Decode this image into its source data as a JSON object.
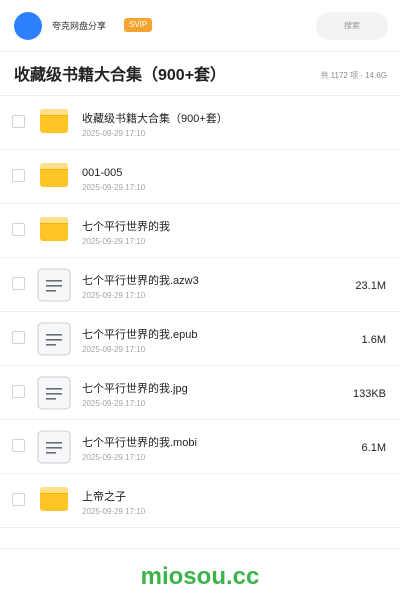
{
  "header": {
    "brand": "夸克网盘分享",
    "badge": "SVIP",
    "search_placeholder": "搜索"
  },
  "folder": {
    "title": "收藏级书籍大合集（900+套）",
    "summary": "共 1172 项 · 14.6G"
  },
  "files": [
    {
      "type": "folder",
      "name": "收藏级书籍大合集（900+套）",
      "date": "2025-09-29 17:10",
      "size": ""
    },
    {
      "type": "folder",
      "name": "001-005",
      "date": "2025-09-29 17:10",
      "size": ""
    },
    {
      "type": "folder",
      "name": "七个平行世界的我",
      "date": "2025-09-29 17:10",
      "size": ""
    },
    {
      "type": "doc",
      "name": "七个平行世界的我.azw3",
      "date": "2025-09-29 17:10",
      "size": "23.1M"
    },
    {
      "type": "doc",
      "name": "七个平行世界的我.epub",
      "date": "2025-09-29 17:10",
      "size": "1.6M"
    },
    {
      "type": "doc",
      "name": "七个平行世界的我.jpg",
      "date": "2025-09-29 17:10",
      "size": "133KB"
    },
    {
      "type": "doc",
      "name": "七个平行世界的我.mobi",
      "date": "2025-09-29 17:10",
      "size": "6.1M"
    },
    {
      "type": "folder",
      "name": "上帝之子",
      "date": "2025-09-29 17:10",
      "size": ""
    }
  ],
  "watermark": "miosou.cc",
  "colors": {
    "avatar": "#2f80ff",
    "badge": "#f5a331",
    "folder": "#ffc425",
    "watermark": "#3cb34a"
  }
}
